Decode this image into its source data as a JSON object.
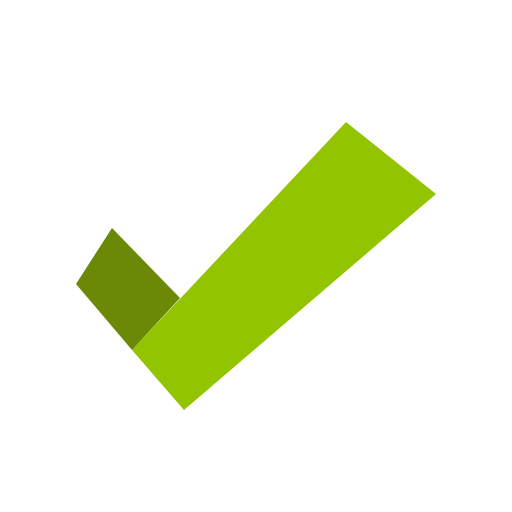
{
  "icon": {
    "name": "checkmark-icon",
    "colors": {
      "background": "#ffffff",
      "short_stroke": "#6b8806",
      "long_stroke": "#92c400"
    }
  }
}
